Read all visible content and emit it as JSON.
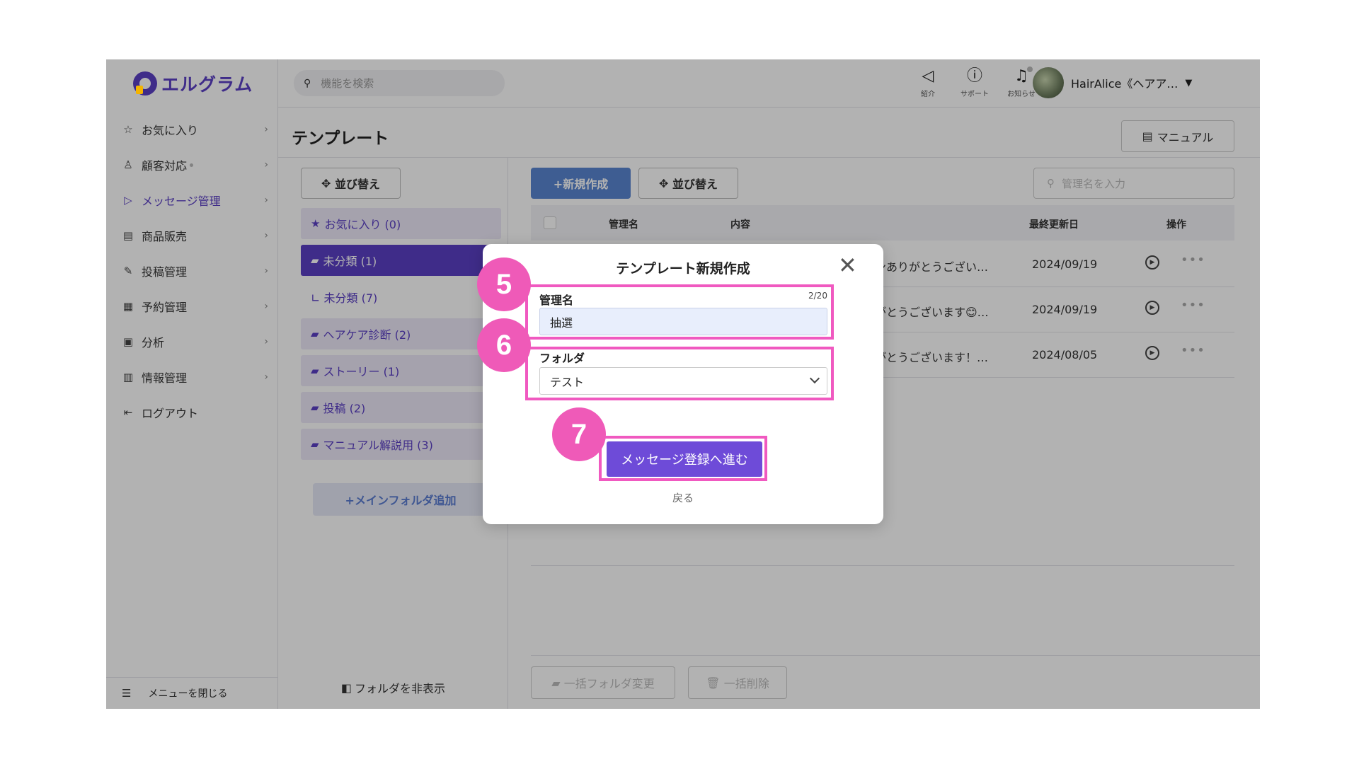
{
  "app": {
    "logo_text": "エルグラム"
  },
  "sidebar": {
    "items": [
      {
        "label": "お気に入り",
        "icon": "star-icon"
      },
      {
        "label": "顧客対応",
        "icon": "person-icon"
      },
      {
        "label": "メッセージ管理",
        "icon": "send-icon",
        "active": true
      },
      {
        "label": "商品販売",
        "icon": "store-icon"
      },
      {
        "label": "投稿管理",
        "icon": "edit-icon"
      },
      {
        "label": "予約管理",
        "icon": "calendar-icon"
      },
      {
        "label": "分析",
        "icon": "analysis-icon"
      },
      {
        "label": "情報管理",
        "icon": "chart-icon"
      },
      {
        "label": "ログアウト",
        "icon": "logout-icon"
      }
    ],
    "close_menu": "メニューを閉じる"
  },
  "header": {
    "search_placeholder": "機能を検索",
    "icons": [
      {
        "label": "紹介",
        "icon": "megaphone-icon"
      },
      {
        "label": "サポート",
        "icon": "help-icon"
      },
      {
        "label": "お知らせ",
        "icon": "bell-icon"
      }
    ],
    "user_name": "HairAlice《ヘアア…"
  },
  "page": {
    "title": "テンプレート",
    "manual_button": "マニュアル"
  },
  "folders": {
    "sort_button": "並び替え",
    "items": [
      {
        "label": "お気に入り (0)",
        "icon": "star-icon"
      },
      {
        "label": "未分類 (1)",
        "icon": "folder-open-icon",
        "selected": true
      },
      {
        "label": "∟ 未分類 (7)",
        "icon": "",
        "sub": true
      },
      {
        "label": "ヘアケア診断 (2)",
        "icon": "folder-icon"
      },
      {
        "label": "ストーリー (1)",
        "icon": "folder-icon"
      },
      {
        "label": "投稿 (2)",
        "icon": "folder-icon"
      },
      {
        "label": "マニュアル解説用 (3)",
        "icon": "folder-icon"
      }
    ],
    "add_folder": "+メインフォルダ追加",
    "hide_folder": "フォルダを非表示"
  },
  "main": {
    "new_button": "+新規作成",
    "sort_button": "並び替え",
    "filter_placeholder": "管理名を入力",
    "columns": {
      "name": "管理名",
      "content": "内容",
      "updated": "最終更新日",
      "actions": "操作"
    },
    "rows": [
      {
        "content": "ョンありがとうござい…",
        "date": "2024/09/19"
      },
      {
        "content": "りがとうございます😊…",
        "date": "2024/09/19"
      },
      {
        "content": "りがとうございます！…",
        "date": "2024/08/05"
      }
    ],
    "bulk_folder_button": "一括フォルダ変更",
    "bulk_delete_button": "一括削除"
  },
  "modal": {
    "title": "テンプレート新規作成",
    "name_label": "管理名",
    "name_count": "2/20",
    "name_value": "抽選",
    "folder_label": "フォルダ",
    "folder_value": "テスト",
    "proceed_button": "メッセージ登録へ進む",
    "back_link": "戻る"
  },
  "annotations": {
    "step_name": "5",
    "step_folder": "6",
    "step_proceed": "7",
    "highlight_color": "#f059c0"
  }
}
